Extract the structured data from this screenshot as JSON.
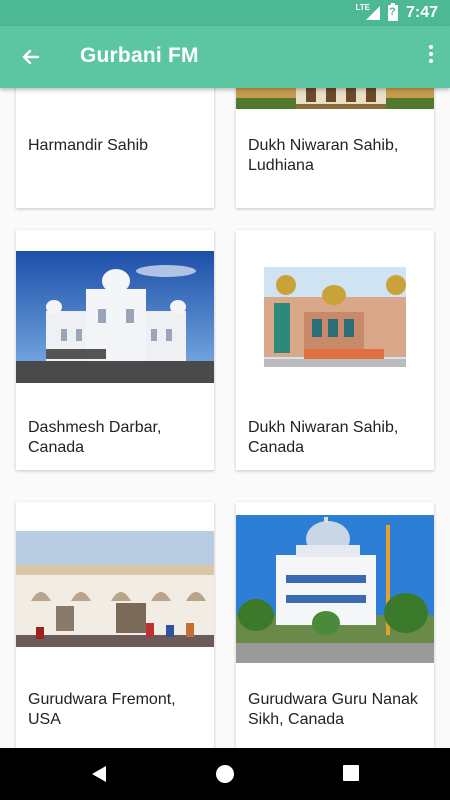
{
  "status_bar": {
    "time": "7:47",
    "network": "LTE",
    "battery_glyph": "?"
  },
  "app_bar": {
    "title": "Gurbani FM",
    "back_icon": "arrow-back-icon",
    "menu_icon": "more-vertical-icon"
  },
  "cards": [
    {
      "name": "Harmandir Sahib"
    },
    {
      "name": "Dukh Niwaran Sahib, Ludhiana"
    },
    {
      "name": "Dashmesh Darbar, Canada"
    },
    {
      "name": "Dukh Niwaran Sahib, Canada"
    },
    {
      "name": "Gurudwara Fremont, USA"
    },
    {
      "name": "Gurudwara Guru Nanak Sikh, Canada"
    }
  ],
  "colors": {
    "status_bar": "#4db894",
    "app_bar": "#5cc5a1",
    "nav_bar": "#000000"
  }
}
